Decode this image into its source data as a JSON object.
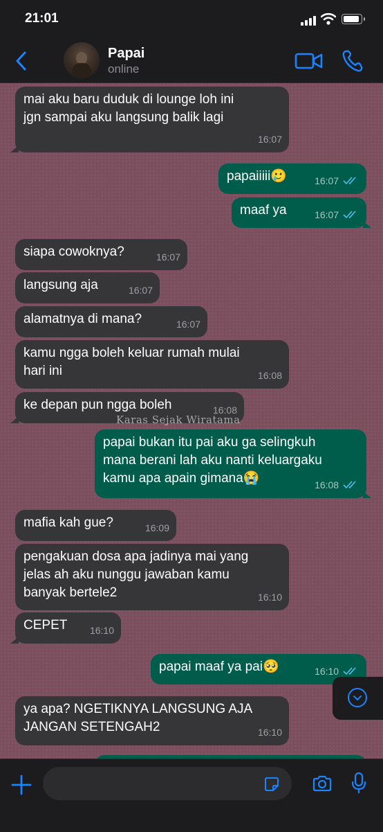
{
  "status_bar": {
    "time": "21:01"
  },
  "header": {
    "contact_name": "Papai",
    "contact_status": "online"
  },
  "colors": {
    "accent": "#1a84ff",
    "incoming_bubble": "#363638",
    "outgoing_bubble": "#005c4b",
    "read_ticks": "#53bdeb",
    "chat_background": "#7c4f5e"
  },
  "icons": {
    "back": "chevron-left-icon",
    "video": "video-camera-icon",
    "call": "phone-icon",
    "plus": "plus-icon",
    "sticker": "sticker-icon",
    "camera": "camera-icon",
    "mic": "microphone-icon",
    "scroll": "chevron-down-icon"
  },
  "overlay_text": "Karas Sejak Wiratama",
  "messages": [
    {
      "dir": "in",
      "text": "mai aku baru duduk di lounge loh ini\njgn sampai aku langsung balik lagi",
      "time": "16:07"
    },
    {
      "dir": "out",
      "text": "papaiiiii🥲",
      "time": "16:07",
      "status": "read"
    },
    {
      "dir": "out",
      "text": "maaf ya",
      "time": "16:07",
      "status": "read"
    },
    {
      "dir": "in",
      "text": "siapa cowoknya?",
      "time": "16:07"
    },
    {
      "dir": "in",
      "text": "langsung aja",
      "time": "16:07"
    },
    {
      "dir": "in",
      "text": "alamatnya di mana?",
      "time": "16:07"
    },
    {
      "dir": "in",
      "text": "kamu ngga boleh keluar rumah mulai\nhari ini",
      "time": "16:08"
    },
    {
      "dir": "in",
      "text": "ke depan pun ngga boleh",
      "time": "16:08"
    },
    {
      "dir": "out",
      "text": "papai bukan itu pai aku ga selingkuh\nmana berani lah aku nanti keluargaku\nkamu apa apain gimana😭",
      "time": "16:08",
      "status": "read"
    },
    {
      "dir": "in",
      "text": "mafia kah gue?",
      "time": "16:09"
    },
    {
      "dir": "in",
      "text": "pengakuan dosa apa jadinya mai yang\njelas ah aku nunggu jawaban kamu\nbanyak bertele2",
      "time": "16:10"
    },
    {
      "dir": "in",
      "text": "CEPET",
      "time": "16:10"
    },
    {
      "dir": "out",
      "text": "papai maaf ya pai🥺",
      "time": "16:10",
      "status": "read"
    },
    {
      "dir": "in",
      "text": "ya apa? NGETIKNYA LANGSUNG AJA\nJANGAN SETENGAH2",
      "time": "16:10"
    },
    {
      "dir": "out",
      "text": "",
      "time": "",
      "status": ""
    }
  ],
  "input": {
    "value": "",
    "placeholder": ""
  }
}
